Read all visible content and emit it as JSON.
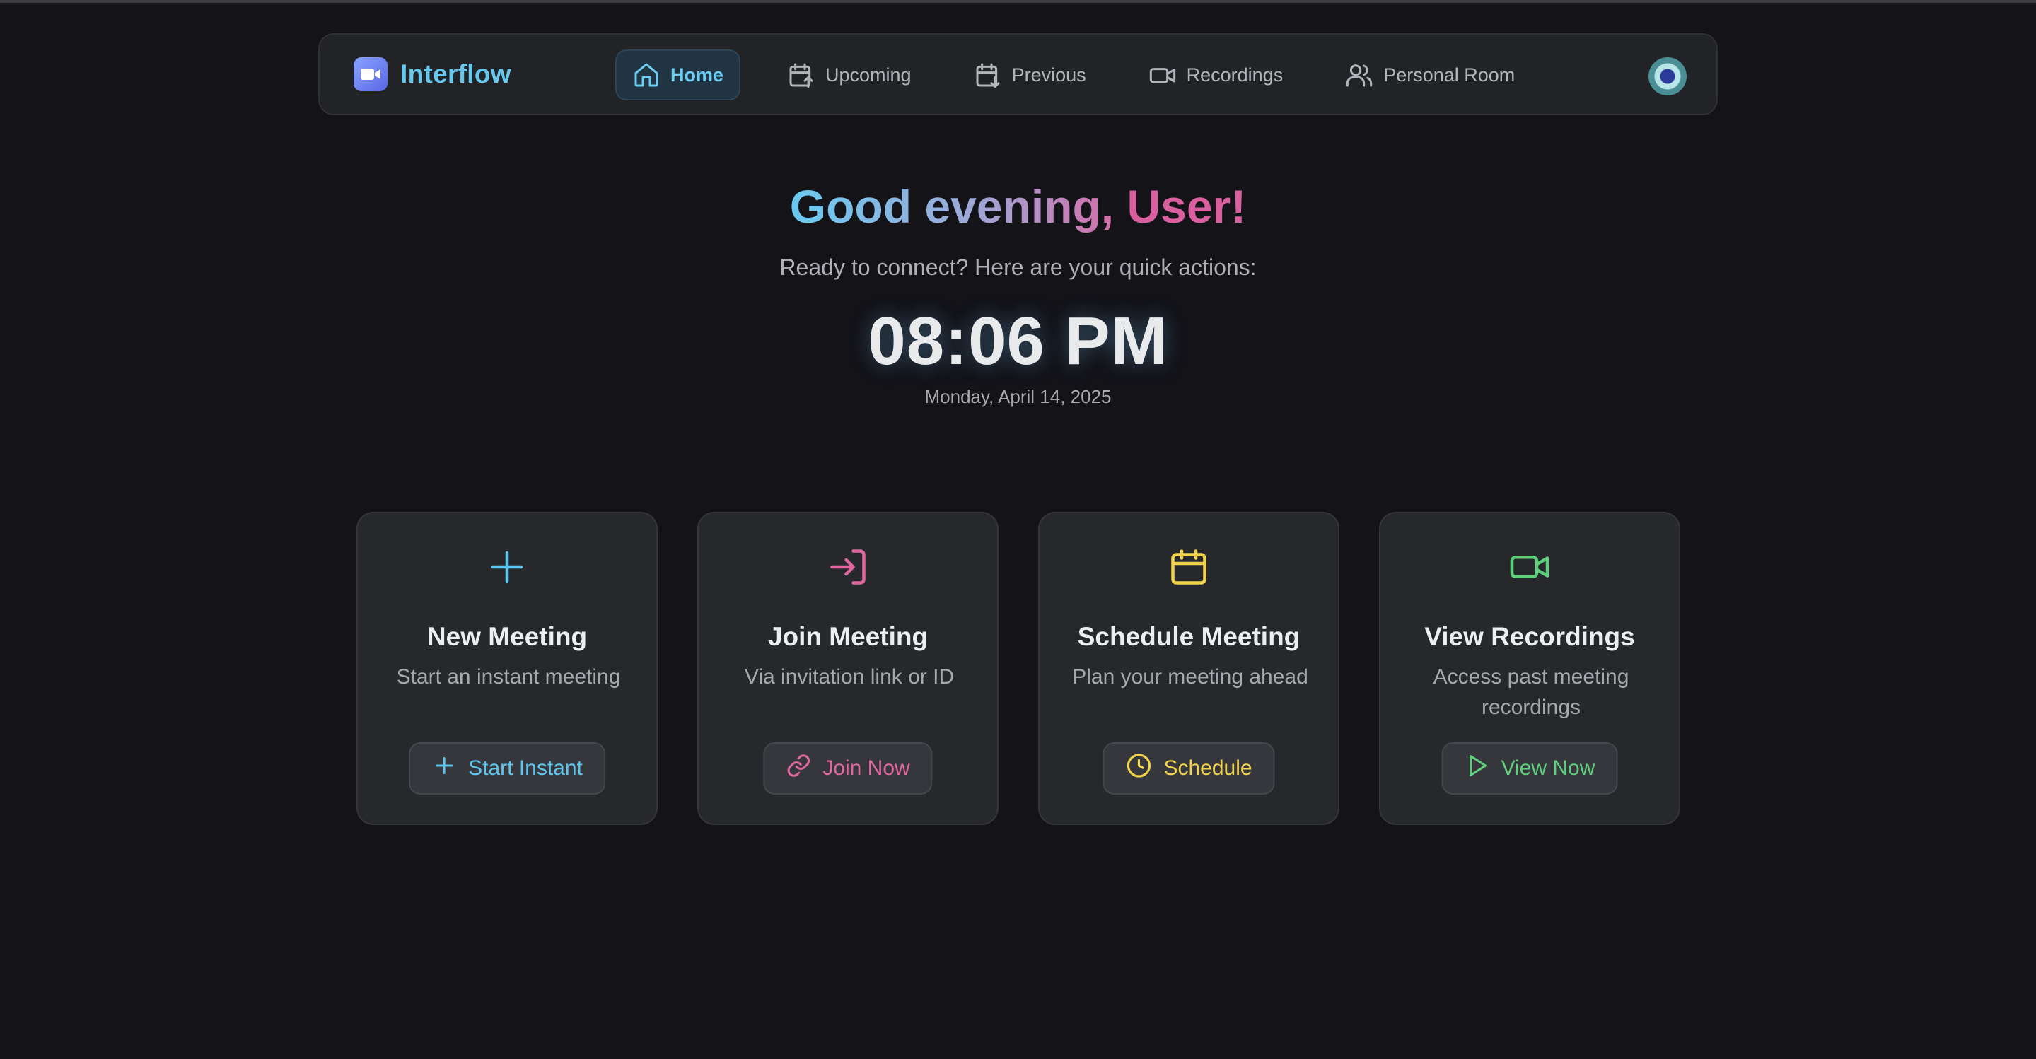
{
  "app": {
    "name": "Interflow"
  },
  "nav": {
    "items": [
      {
        "label": "Home",
        "icon": "home-icon",
        "active": true
      },
      {
        "label": "Upcoming",
        "icon": "calendar-up-icon",
        "active": false
      },
      {
        "label": "Previous",
        "icon": "calendar-down-icon",
        "active": false
      },
      {
        "label": "Recordings",
        "icon": "video-icon",
        "active": false
      },
      {
        "label": "Personal Room",
        "icon": "users-icon",
        "active": false
      }
    ]
  },
  "hero": {
    "greeting": "Good evening, ",
    "user": "User!",
    "subtitle": "Ready to connect? Here are your quick actions:",
    "time": "08:06 PM",
    "date": "Monday, April 14, 2025"
  },
  "cards": [
    {
      "title": "New Meeting",
      "desc": "Start an instant meeting",
      "button": "Start Instant",
      "icon": "plus-icon",
      "button_icon": "plus-icon",
      "color": "#5ec6ee"
    },
    {
      "title": "Join Meeting",
      "desc": "Via invitation link or ID",
      "button": "Join Now",
      "icon": "login-icon",
      "button_icon": "link-icon",
      "color": "#e0679f"
    },
    {
      "title": "Schedule Meeting",
      "desc": "Plan your meeting ahead",
      "button": "Schedule",
      "icon": "calendar-icon",
      "button_icon": "clock-icon",
      "color": "#f1d44b"
    },
    {
      "title": "View Recordings",
      "desc": "Access past meeting recordings",
      "button": "View Now",
      "icon": "video-icon",
      "button_icon": "play-icon",
      "color": "#5fcf7d"
    }
  ],
  "colors": {
    "background": "#131318",
    "navbar": "#222327",
    "card": "#27282c",
    "accent": "#6ccdf0"
  }
}
